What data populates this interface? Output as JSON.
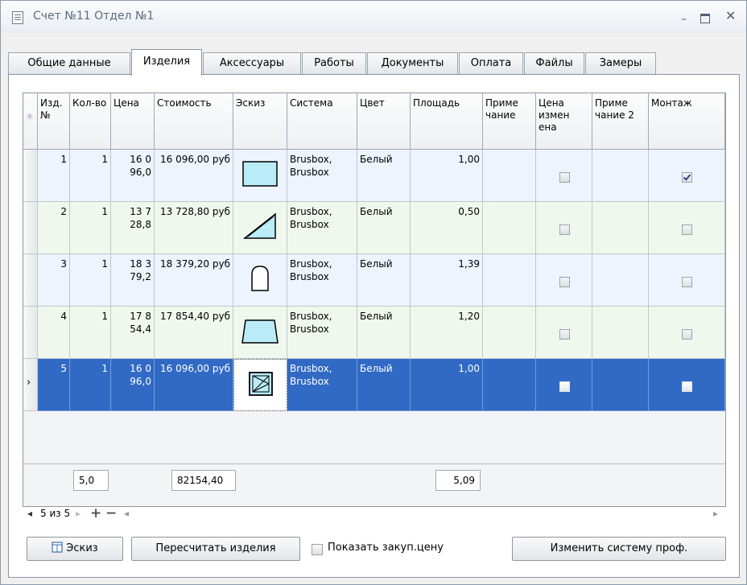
{
  "window": {
    "title": "Счет №11 Отдел №1"
  },
  "tabs": [
    {
      "label": "Общие данные",
      "active": false
    },
    {
      "label": "Изделия",
      "active": true
    },
    {
      "label": "Аксессуары",
      "active": false
    },
    {
      "label": "Работы",
      "active": false
    },
    {
      "label": "Документы",
      "active": false
    },
    {
      "label": "Оплата",
      "active": false
    },
    {
      "label": "Файлы",
      "active": false
    },
    {
      "label": "Замеры",
      "active": false
    }
  ],
  "columns": {
    "new_row": "✳",
    "izd_num": "Изд.№",
    "qty": "Кол-во",
    "price": "Цена",
    "cost": "Стоимость",
    "sketch": "Эскиз",
    "system": "Система",
    "color": "Цвет",
    "area": "Площадь",
    "note": "Приме чание",
    "price_changed": "Цена измен ена",
    "note2": "Приме чание 2",
    "montage": "Монтаж"
  },
  "rows": [
    {
      "num": "1",
      "qty": "1",
      "price": "16 0 96,0",
      "cost": "16 096,00 руб",
      "sketch": "rectangle",
      "system": "Brusbox, Brusbox",
      "color": "Белый",
      "area": "1,00",
      "note": "",
      "price_changed": false,
      "note2": "",
      "montage": true
    },
    {
      "num": "2",
      "qty": "1",
      "price": "13 7 28,8",
      "cost": "13 728,80 руб",
      "sketch": "triangle",
      "system": "Brusbox, Brusbox",
      "color": "Белый",
      "area": "0,50",
      "note": "",
      "price_changed": false,
      "note2": "",
      "montage": false
    },
    {
      "num": "3",
      "qty": "1",
      "price": "18 3 79,2",
      "cost": "18 379,20 руб",
      "sketch": "arch",
      "system": "Brusbox, Brusbox",
      "color": "Белый",
      "area": "1,39",
      "note": "",
      "price_changed": false,
      "note2": "",
      "montage": false
    },
    {
      "num": "4",
      "qty": "1",
      "price": "17 8 54,4",
      "cost": "17 854,40 руб",
      "sketch": "trapezoid",
      "system": "Brusbox, Brusbox",
      "color": "Белый",
      "area": "1,20",
      "note": "",
      "price_changed": false,
      "note2": "",
      "montage": false
    },
    {
      "num": "5",
      "qty": "1",
      "price": "16 0 96,0",
      "cost": "16 096,00 руб",
      "sketch": "sash-window",
      "system": "Brusbox, Brusbox",
      "color": "Белый",
      "area": "1,00",
      "note": "",
      "price_changed": false,
      "note2": "",
      "montage": false
    }
  ],
  "selected_row": 5,
  "totals": {
    "qty": "5,0",
    "cost": "82154,40",
    "area": "5,09"
  },
  "navigator": {
    "position": "5 из 5"
  },
  "buttons": {
    "sketch": "Эскиз",
    "recalc": "Пересчитать изделия",
    "show_purchase_price": "Показать закуп.цену",
    "change_profile": "Изменить систему проф."
  },
  "colors": {
    "selection": "#316ac5",
    "row_odd": "#edf4fd",
    "row_even": "#f0f8ee"
  }
}
